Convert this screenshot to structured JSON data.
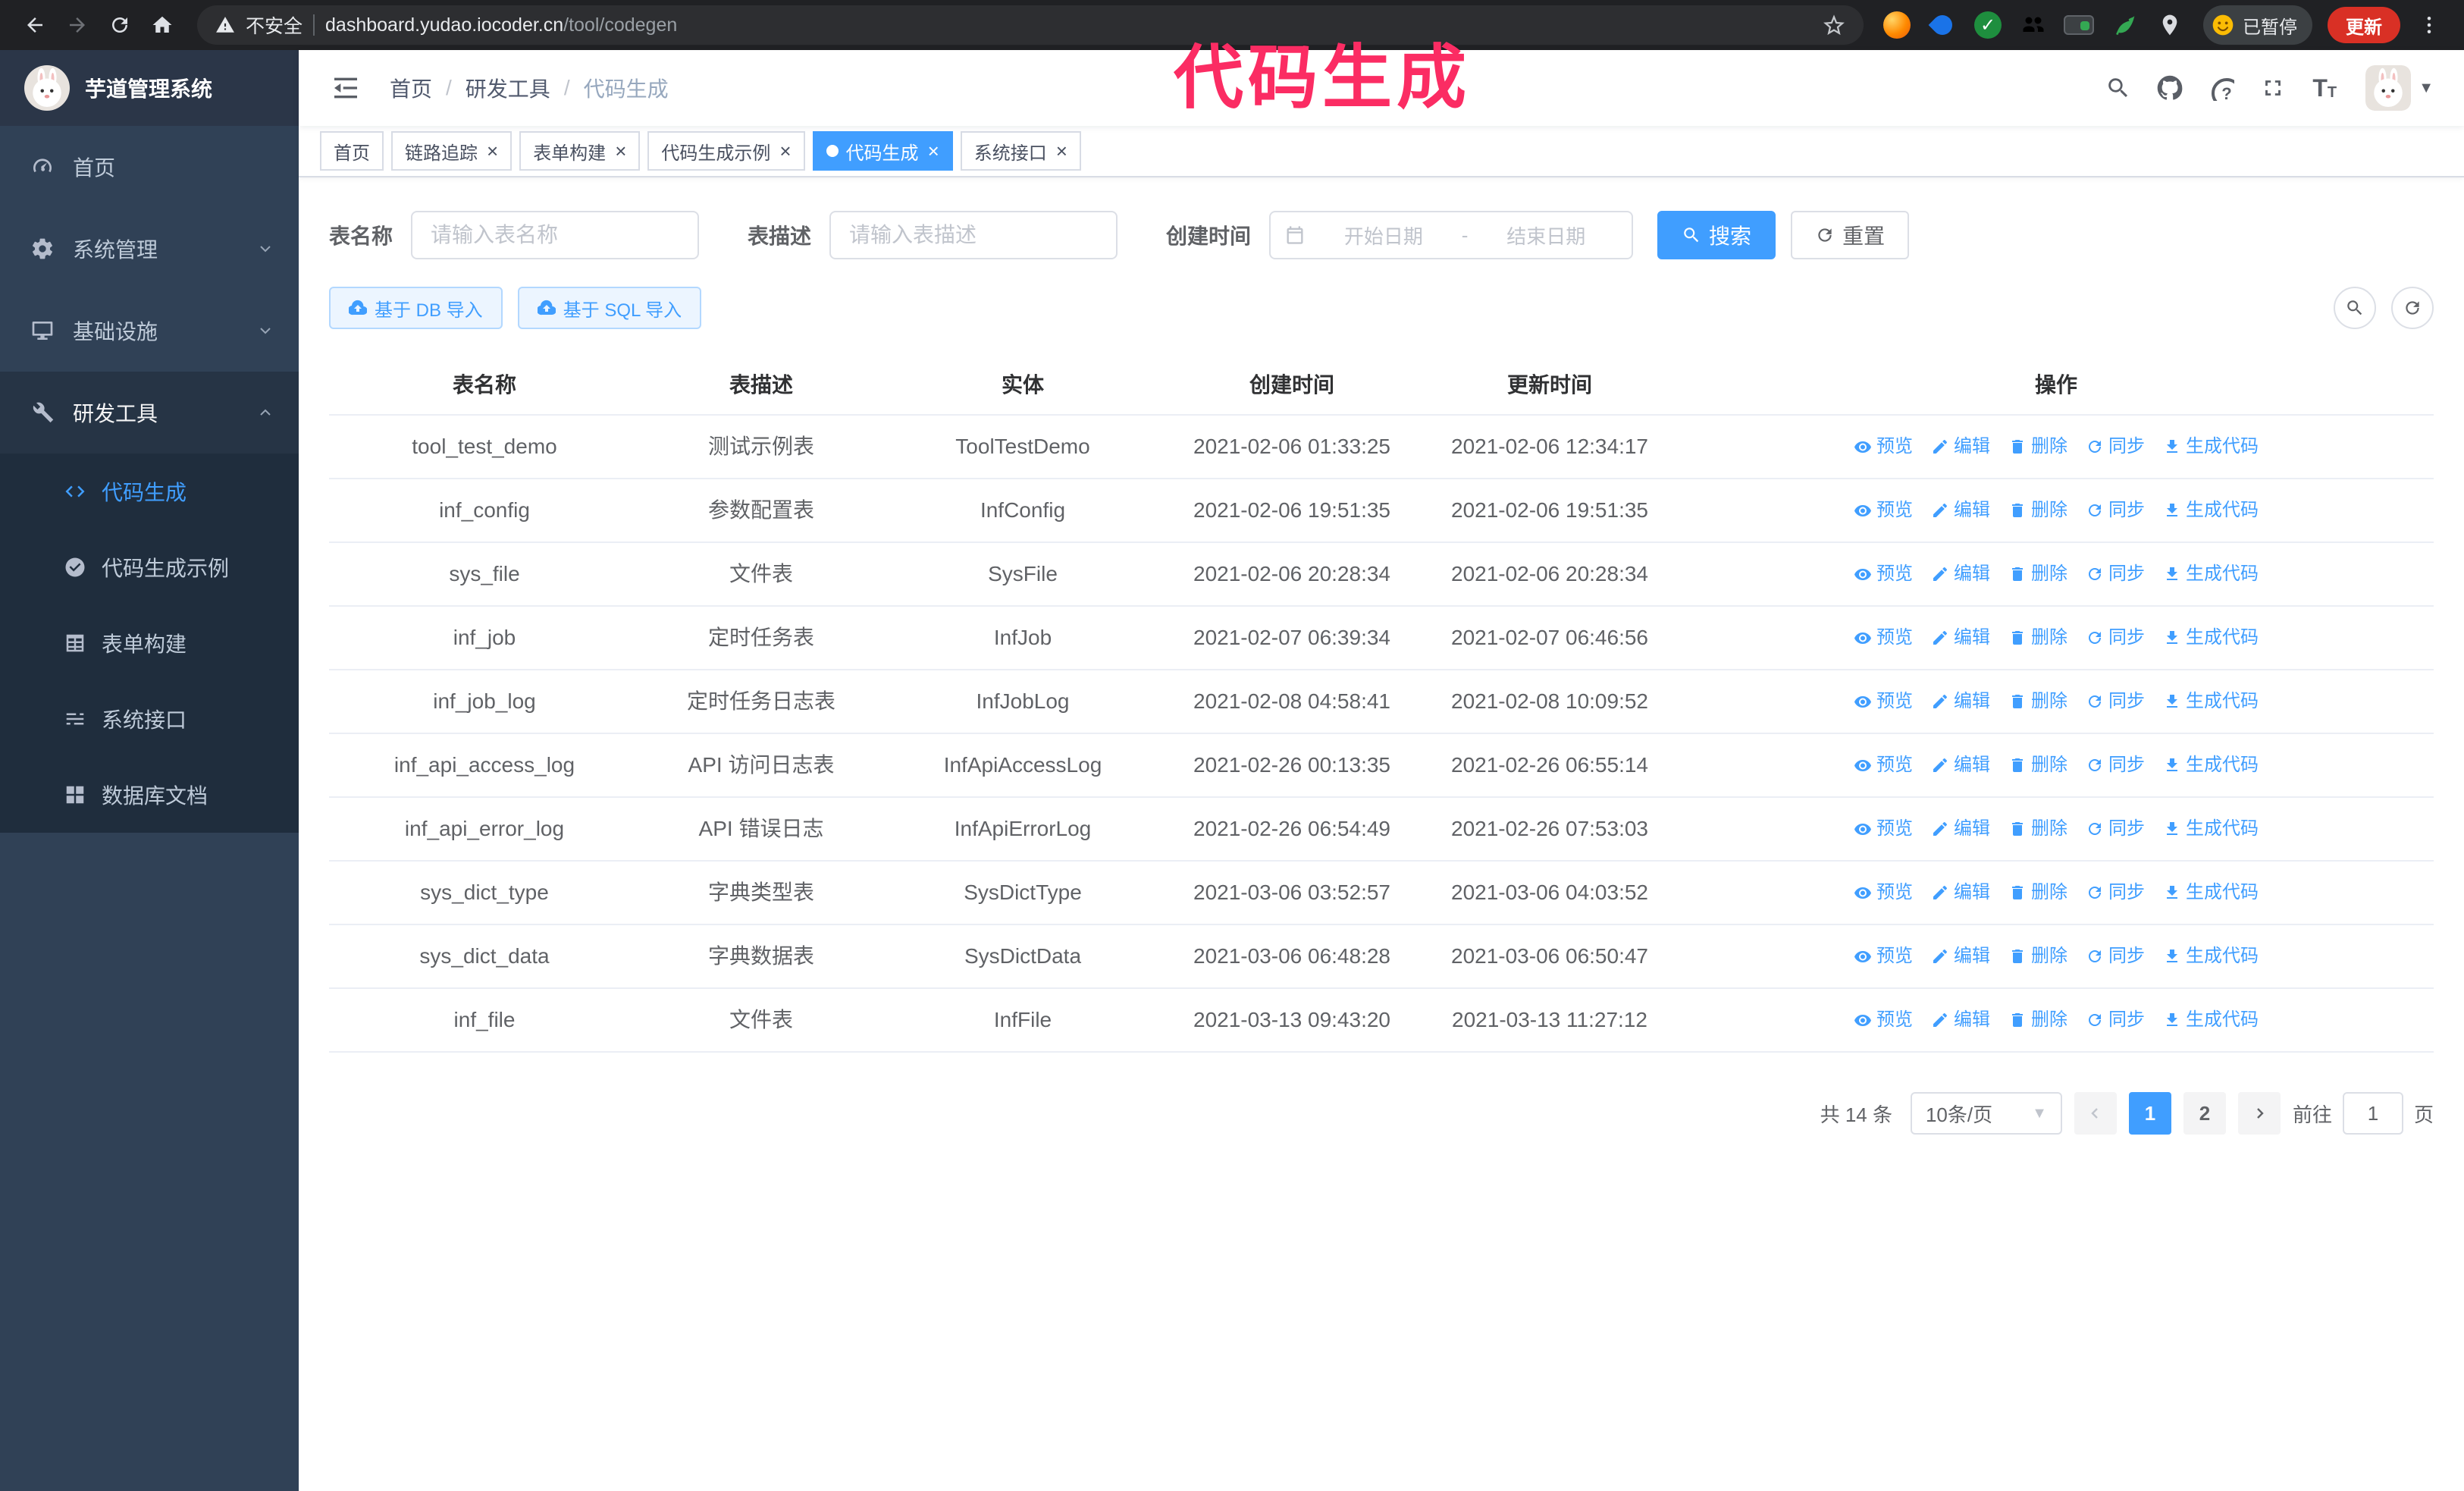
{
  "browser": {
    "security_label": "不安全",
    "url_host": "dashboard.yudao.iocoder.cn",
    "url_path": "/tool/codegen",
    "profile_badge": "已暂停",
    "update_button": "更新"
  },
  "overlay": {
    "text": "代码生成",
    "color": "#fb2c63"
  },
  "sidebar": {
    "app_title": "芋道管理系统",
    "items": [
      {
        "label": "首页",
        "icon": "dashboard-icon",
        "chevron": null,
        "open": false
      },
      {
        "label": "系统管理",
        "icon": "gear-icon",
        "chevron": "down",
        "open": false
      },
      {
        "label": "基础设施",
        "icon": "infrastructure-icon",
        "chevron": "down",
        "open": false
      },
      {
        "label": "研发工具",
        "icon": "tools-icon",
        "chevron": "up",
        "open": true
      }
    ],
    "submenu": [
      {
        "label": "代码生成",
        "icon": "code-icon",
        "active": true
      },
      {
        "label": "代码生成示例",
        "icon": "example-icon",
        "active": false
      },
      {
        "label": "表单构建",
        "icon": "form-icon",
        "active": false
      },
      {
        "label": "系统接口",
        "icon": "api-icon",
        "active": false
      },
      {
        "label": "数据库文档",
        "icon": "database-doc-icon",
        "active": false
      }
    ]
  },
  "breadcrumb": [
    "首页",
    "研发工具",
    "代码生成"
  ],
  "tabs": [
    {
      "label": "首页",
      "closable": false,
      "active": false
    },
    {
      "label": "链路追踪",
      "closable": true,
      "active": false
    },
    {
      "label": "表单构建",
      "closable": true,
      "active": false
    },
    {
      "label": "代码生成示例",
      "closable": true,
      "active": false
    },
    {
      "label": "代码生成",
      "closable": true,
      "active": true
    },
    {
      "label": "系统接口",
      "closable": true,
      "active": false
    }
  ],
  "filters": {
    "table_name_label": "表名称",
    "table_name_placeholder": "请输入表名称",
    "table_desc_label": "表描述",
    "table_desc_placeholder": "请输入表描述",
    "create_time_label": "创建时间",
    "start_date_placeholder": "开始日期",
    "range_separator": "-",
    "end_date_placeholder": "结束日期",
    "search_button": "搜索",
    "reset_button": "重置"
  },
  "toolbar": {
    "import_db_button": "基于 DB 导入",
    "import_sql_button": "基于 SQL 导入"
  },
  "table": {
    "columns": [
      "表名称",
      "表描述",
      "实体",
      "创建时间",
      "更新时间",
      "操作"
    ],
    "actions": [
      "预览",
      "编辑",
      "删除",
      "同步",
      "生成代码"
    ],
    "rows": [
      {
        "name": "tool_test_demo",
        "desc": "测试示例表",
        "entity": "ToolTestDemo",
        "created": "2021-02-06 01:33:25",
        "updated": "2021-02-06 12:34:17"
      },
      {
        "name": "inf_config",
        "desc": "参数配置表",
        "entity": "InfConfig",
        "created": "2021-02-06 19:51:35",
        "updated": "2021-02-06 19:51:35"
      },
      {
        "name": "sys_file",
        "desc": "文件表",
        "entity": "SysFile",
        "created": "2021-02-06 20:28:34",
        "updated": "2021-02-06 20:28:34"
      },
      {
        "name": "inf_job",
        "desc": "定时任务表",
        "entity": "InfJob",
        "created": "2021-02-07 06:39:34",
        "updated": "2021-02-07 06:46:56"
      },
      {
        "name": "inf_job_log",
        "desc": "定时任务日志表",
        "entity": "InfJobLog",
        "created": "2021-02-08 04:58:41",
        "updated": "2021-02-08 10:09:52"
      },
      {
        "name": "inf_api_access_log",
        "desc": "API 访问日志表",
        "entity": "InfApiAccessLog",
        "created": "2021-02-26 00:13:35",
        "updated": "2021-02-26 06:55:14"
      },
      {
        "name": "inf_api_error_log",
        "desc": "API 错误日志",
        "entity": "InfApiErrorLog",
        "created": "2021-02-26 06:54:49",
        "updated": "2021-02-26 07:53:03"
      },
      {
        "name": "sys_dict_type",
        "desc": "字典类型表",
        "entity": "SysDictType",
        "created": "2021-03-06 03:52:57",
        "updated": "2021-03-06 04:03:52"
      },
      {
        "name": "sys_dict_data",
        "desc": "字典数据表",
        "entity": "SysDictData",
        "created": "2021-03-06 06:48:28",
        "updated": "2021-03-06 06:50:47"
      },
      {
        "name": "inf_file",
        "desc": "文件表",
        "entity": "InfFile",
        "created": "2021-03-13 09:43:20",
        "updated": "2021-03-13 11:27:12"
      }
    ]
  },
  "pagination": {
    "total": "共 14 条",
    "page_size": "10条/页",
    "pages": [
      "1",
      "2"
    ],
    "current": "1",
    "goto_label": "前往",
    "goto_value": "1",
    "page_label": "页"
  }
}
